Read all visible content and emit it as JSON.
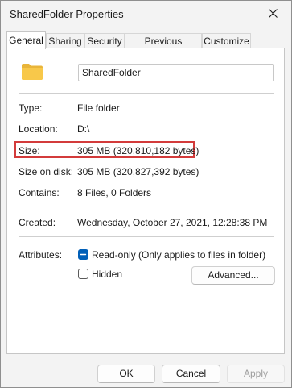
{
  "window": {
    "title": "SharedFolder Properties"
  },
  "tabs": [
    {
      "label": "General",
      "active": true
    },
    {
      "label": "Sharing",
      "active": false
    },
    {
      "label": "Security",
      "active": false
    },
    {
      "label": "Previous Versions",
      "active": false
    },
    {
      "label": "Customize",
      "active": false
    }
  ],
  "general": {
    "folder_icon": "folder-icon",
    "name_value": "SharedFolder",
    "type_label": "Type:",
    "type_value": "File folder",
    "location_label": "Location:",
    "location_value": "D:\\",
    "size_label": "Size:",
    "size_value": "305 MB (320,810,182 bytes)",
    "size_on_disk_label": "Size on disk:",
    "size_on_disk_value": "305 MB (320,827,392 bytes)",
    "contains_label": "Contains:",
    "contains_value": "8 Files, 0 Folders",
    "created_label": "Created:",
    "created_value": "Wednesday, October 27, 2021, 12:28:38 PM",
    "attributes_label": "Attributes:",
    "readonly_label": "Read-only (Only applies to files in folder)",
    "readonly_checked": true,
    "hidden_label": "Hidden",
    "hidden_checked": false,
    "advanced_button": "Advanced..."
  },
  "footer": {
    "ok_button": "OK",
    "cancel_button": "Cancel",
    "apply_button": "Apply",
    "apply_enabled": false
  },
  "colors": {
    "highlight": "#d33b3b",
    "checkbox_accent": "#005fb8",
    "folder_yellow": "#f8c84a"
  }
}
